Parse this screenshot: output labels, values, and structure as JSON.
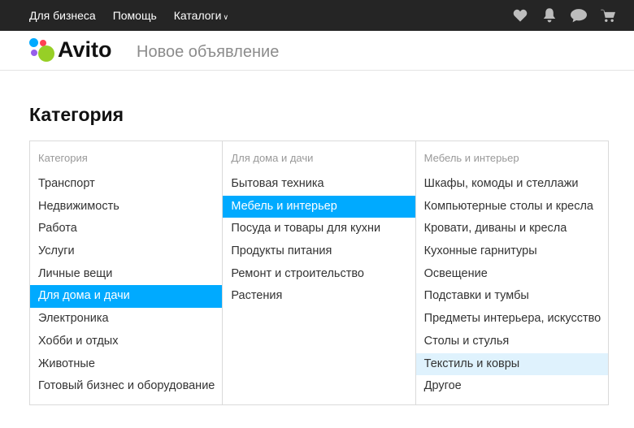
{
  "topbar": {
    "nav": [
      "Для бизнеса",
      "Помощь",
      "Каталоги"
    ],
    "icons": [
      "heart-icon",
      "bell-icon",
      "chat-icon",
      "cart-icon"
    ]
  },
  "header": {
    "logo_text": "Avito",
    "page_subtitle": "Новое объявление"
  },
  "page_title": "Категория",
  "columns": [
    {
      "title": "Категория",
      "items": [
        "Транспорт",
        "Недвижимость",
        "Работа",
        "Услуги",
        "Личные вещи",
        "Для дома и дачи",
        "Электроника",
        "Хобби и отдых",
        "Животные",
        "Готовый бизнес и оборудование"
      ],
      "selected": 5
    },
    {
      "title": "Для дома и дачи",
      "items": [
        "Бытовая техника",
        "Мебель и интерьер",
        "Посуда и товары для кухни",
        "Продукты питания",
        "Ремонт и строительство",
        "Растения"
      ],
      "selected": 1
    },
    {
      "title": "Мебель и интерьер",
      "items": [
        "Шкафы, комоды и стеллажи",
        "Компьютерные столы и кресла",
        "Кровати, диваны и кресла",
        "Кухонные гарнитуры",
        "Освещение",
        "Подставки и тумбы",
        "Предметы интерьера, искусство",
        "Столы и стулья",
        "Текстиль и ковры",
        "Другое"
      ],
      "hovered": 8
    }
  ],
  "colors": {
    "topbar": "#252525",
    "selected": "#00aaff",
    "hover": "#dff2fd",
    "logo_dots": [
      "#00aaff",
      "#ff4053",
      "#965eeb",
      "#97cf26"
    ]
  }
}
